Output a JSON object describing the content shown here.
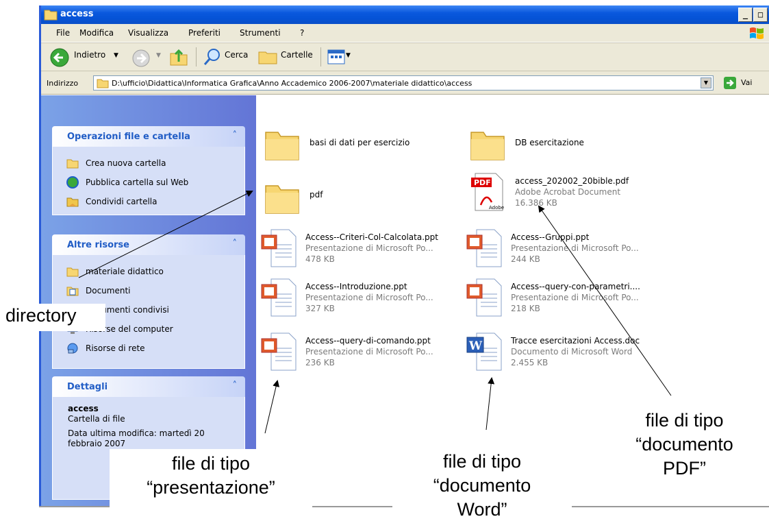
{
  "window": {
    "title": "access"
  },
  "menu": [
    "File",
    "Modifica",
    "Visualizza",
    "Preferiti",
    "Strumenti",
    "?"
  ],
  "toolbar": {
    "back": "Indietro",
    "search": "Cerca",
    "folders": "Cartelle"
  },
  "address": {
    "label": "Indirizzo",
    "path": "D:\\ufficio\\Didattica\\Informatica Grafica\\Anno Accademico 2006-2007\\materiale didattico\\access",
    "go": "Vai"
  },
  "panels": {
    "tasks": {
      "title": "Operazioni file e cartella",
      "items": [
        "Crea nuova cartella",
        "Pubblica cartella sul Web",
        "Condividi cartella"
      ]
    },
    "other": {
      "title": "Altre risorse",
      "items": [
        "materiale didattico",
        "Documenti",
        "Documenti condivisi",
        "Risorse del computer",
        "Risorse di rete"
      ]
    },
    "details": {
      "title": "Dettagli",
      "name": "access",
      "type": "Cartella di file",
      "modified": "Data ultima modifica: martedì 20 febbraio 2007"
    }
  },
  "files": [
    {
      "name": "basi di dati per esercizio",
      "kind": "folder"
    },
    {
      "name": "DB esercitazione",
      "kind": "folder"
    },
    {
      "name": "pdf",
      "kind": "folder"
    },
    {
      "name": "access_202002_20bible.pdf",
      "sub": "Adobe Acrobat Document",
      "size": "16.386 KB",
      "kind": "pdf"
    },
    {
      "name": "Access--Criteri-Col-Calcolata.ppt",
      "sub": "Presentazione di Microsoft Po...",
      "size": "478 KB",
      "kind": "ppt"
    },
    {
      "name": "Access--Gruppi.ppt",
      "sub": "Presentazione di Microsoft Po...",
      "size": "244 KB",
      "kind": "ppt"
    },
    {
      "name": "Access--Introduzione.ppt",
      "sub": "Presentazione di Microsoft Po...",
      "size": "327 KB",
      "kind": "ppt"
    },
    {
      "name": "Access--query-con-parametri....",
      "sub": "Presentazione di Microsoft Po...",
      "size": "218 KB",
      "kind": "ppt"
    },
    {
      "name": "Access--query-di-comando.ppt",
      "sub": "Presentazione di Microsoft Po...",
      "size": "236 KB",
      "kind": "ppt"
    },
    {
      "name": "Tracce esercitazioni Access.doc",
      "sub": "Documento di Microsoft Word",
      "size": "2.455 KB",
      "kind": "doc"
    }
  ],
  "annotations": {
    "directory": "directory",
    "ppt_line1": "file di tipo",
    "ppt_line2": "“presentazione”",
    "word_line1": "file di tipo",
    "word_line2": "“documento",
    "word_line3": "Word”",
    "pdf_line1": "file di tipo",
    "pdf_line2": "“documento",
    "pdf_line3": "PDF”"
  }
}
